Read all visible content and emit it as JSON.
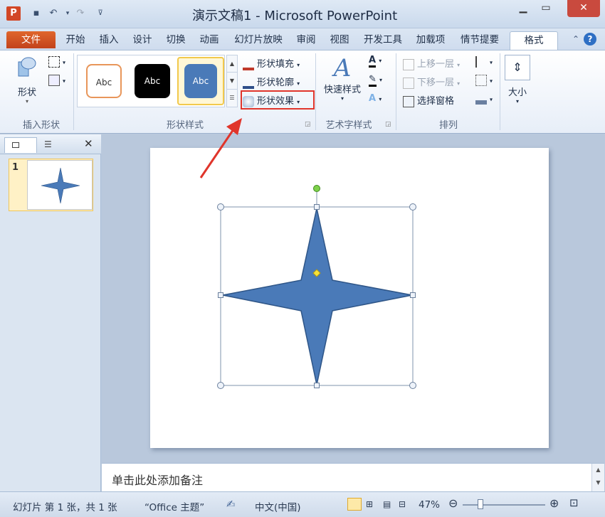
{
  "window": {
    "title": "演示文稿1 - Microsoft PowerPoint",
    "app_icon_letter": "P"
  },
  "tabs": [
    "文件",
    "开始",
    "插入",
    "设计",
    "切换",
    "动画",
    "幻灯片放映",
    "审阅",
    "视图",
    "开发工具",
    "加载项",
    "情节提要",
    "格式"
  ],
  "ribbon": {
    "insert_shapes": {
      "shapes_label": "形状",
      "group_label": "插入形状"
    },
    "shape_styles": {
      "gallery": [
        "Abc",
        "Abc",
        "Abc"
      ],
      "fill": "形状填充",
      "outline": "形状轮廓",
      "effects": "形状效果",
      "group_label": "形状样式"
    },
    "wordart": {
      "quick_styles": "快速样式",
      "group_label": "艺术字样式"
    },
    "arrange": {
      "bring_forward": "上移一层",
      "send_backward": "下移一层",
      "selection_pane": "选择窗格",
      "group_label": "排列"
    },
    "size": {
      "label": "大小"
    }
  },
  "slides_panel": {
    "slide_number": "1"
  },
  "notes": {
    "placeholder": "单击此处添加备注"
  },
  "status": {
    "slide_info": "幻灯片 第 1 张，共 1 张",
    "theme": "“Office 主题”",
    "language": "中文(中国)",
    "zoom": "47%"
  },
  "colors": {
    "shape_fill": "#4a7ab8",
    "accent_red": "#e0352b",
    "file_tab": "#d24726"
  }
}
